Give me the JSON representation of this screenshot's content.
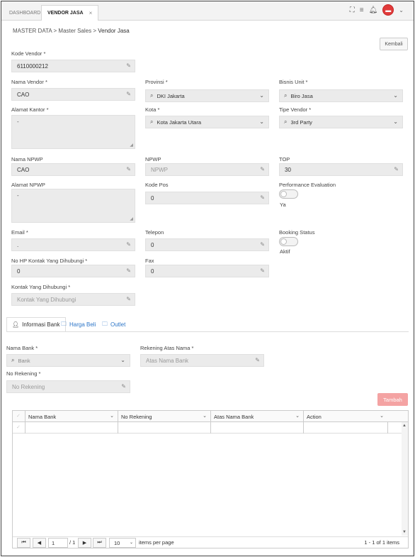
{
  "tabs": {
    "dashboard": "DASHBOARD",
    "active": "VENDOR JASA",
    "close": "×"
  },
  "breadcrumb": {
    "root": "MASTER DATA",
    "sep1": ">",
    "mid": "Master Sales",
    "sep2": ">",
    "current": "Vendor Jasa"
  },
  "buttons": {
    "kembali": "Kembali",
    "tambah": "Tambah"
  },
  "form": {
    "kode_vendor": {
      "label": "Kode Vendor *",
      "value": "6110000212"
    },
    "nama_vendor": {
      "label": "Nama Vendor *",
      "value": "CAO"
    },
    "provinsi": {
      "label": "Provinsi *",
      "value": "DKI Jakarta"
    },
    "bisnis_unit": {
      "label": "Bisnis Unit *",
      "value": "Biro Jasa"
    },
    "alamat_kantor": {
      "label": "Alamat Kantor *",
      "value": "-"
    },
    "kota": {
      "label": "Kota *",
      "value": "Kota Jakarta Utara"
    },
    "tipe_vendor": {
      "label": "Tipe Vendor *",
      "value": "3rd Party"
    },
    "nama_npwp": {
      "label": "Nama NPWP",
      "value": "CAO"
    },
    "npwp": {
      "label": "NPWP",
      "placeholder": "NPWP"
    },
    "top": {
      "label": "TOP",
      "value": "30"
    },
    "alamat_npwp": {
      "label": "Alamat NPWP",
      "value": "-"
    },
    "kode_pos": {
      "label": "Kode Pos",
      "value": "0"
    },
    "performance_evaluation": {
      "label": "Performance Evaluation",
      "state_text": "Ya"
    },
    "email": {
      "label": "Email *",
      "value": "."
    },
    "telepon": {
      "label": "Telepon",
      "value": "0"
    },
    "booking_status": {
      "label": "Booking Status",
      "state_text": "Aktif"
    },
    "no_hp": {
      "label": "No HP Kontak Yang Dihubungi *",
      "value": "0"
    },
    "fax": {
      "label": "Fax",
      "value": "0"
    },
    "kontak": {
      "label": "Kontak Yang Dihubungi *",
      "placeholder": "Kontak Yang Dihubungi"
    }
  },
  "bottom_tabs": [
    "Informasi Bank",
    "Harga Beli",
    "Outlet"
  ],
  "bank": {
    "nama_bank": {
      "label": "Nama Bank *",
      "placeholder": "Bank"
    },
    "rekening_atas_nama": {
      "label": "Rekening Atas Nama *",
      "placeholder": "Atas Nama Bank"
    },
    "no_rekening": {
      "label": "No Rekening *",
      "placeholder": "No Rekening"
    }
  },
  "grid": {
    "columns": [
      "Nama Bank",
      "No Rekening",
      "Atas Nama Bank",
      "Action"
    ],
    "rows": []
  },
  "pager": {
    "page": "1",
    "of": "/ 1",
    "page_size": "10",
    "items_per_page": "items per page",
    "summary": "1 - 1 of 1 items"
  },
  "colors": {
    "accent": "#2d76c8",
    "tambah": "#f4a3a3",
    "avatar": "#e03a3a"
  },
  "icons": [
    "expand-icon",
    "menu-icon",
    "bell-icon",
    "avatar-icon",
    "chevron-down-icon",
    "pencil-icon",
    "search-icon",
    "user-icon",
    "folder-icon",
    "checkbox-icon"
  ]
}
